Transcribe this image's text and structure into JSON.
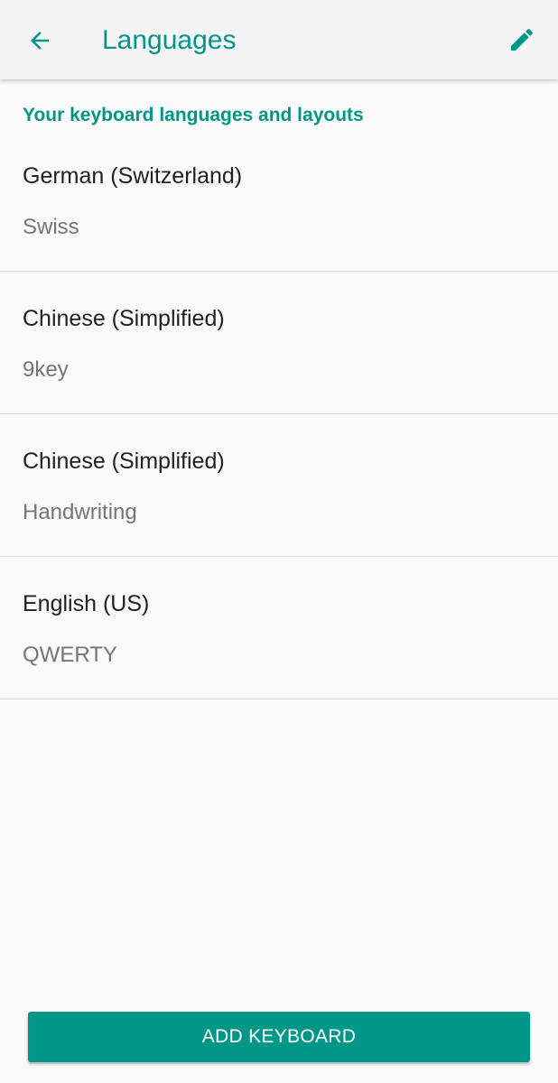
{
  "app_bar": {
    "back_icon": "arrow-left-icon",
    "title": "Languages",
    "edit_icon": "pencil-icon"
  },
  "section_header": "Your keyboard languages and layouts",
  "languages": [
    {
      "name": "German (Switzerland)",
      "layout": "Swiss"
    },
    {
      "name": "Chinese (Simplified)",
      "layout": "9key"
    },
    {
      "name": "Chinese (Simplified)",
      "layout": "Handwriting"
    },
    {
      "name": "English (US)",
      "layout": "QWERTY"
    }
  ],
  "add_button_label": "ADD KEYBOARD",
  "colors": {
    "accent": "#009688",
    "app_bar_bg": "#f5f5f5",
    "background": "#fafafa",
    "primary_text": "#212121",
    "secondary_text": "#757575",
    "divider": "#dcdcdc"
  }
}
